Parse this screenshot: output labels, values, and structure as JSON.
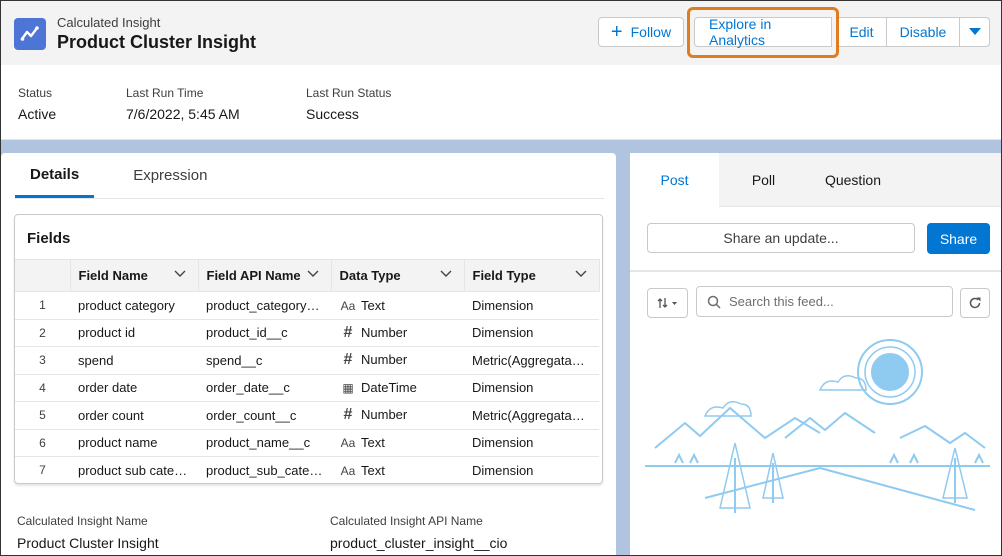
{
  "header": {
    "object_type": "Calculated Insight",
    "title": "Product Cluster Insight",
    "buttons": {
      "follow": "Follow",
      "explore": "Explore in Analytics",
      "edit": "Edit",
      "disable": "Disable"
    }
  },
  "highlights": [
    {
      "label": "Status",
      "value": "Active"
    },
    {
      "label": "Last Run Time",
      "value": "7/6/2022, 5:45 AM"
    },
    {
      "label": "Last Run Status",
      "value": "Success"
    }
  ],
  "tabs": {
    "details": "Details",
    "expression": "Expression"
  },
  "fields": {
    "title": "Fields",
    "columns": [
      "Field Name",
      "Field API Name",
      "Data Type",
      "Field Type"
    ],
    "rows": [
      {
        "n": "1",
        "name": "product category",
        "api": "product_category__c",
        "dtype": "Text",
        "dicon": "text-type-icon",
        "ftype": "Dimension"
      },
      {
        "n": "2",
        "name": "product id",
        "api": "product_id__c",
        "dtype": "Number",
        "dicon": "number-type-icon",
        "ftype": "Dimension"
      },
      {
        "n": "3",
        "name": "spend",
        "api": "spend__c",
        "dtype": "Number",
        "dicon": "number-type-icon",
        "ftype": "Metric(Aggregatabl..."
      },
      {
        "n": "4",
        "name": "order date",
        "api": "order_date__c",
        "dtype": "DateTime",
        "dicon": "calendar-type-icon",
        "ftype": "Dimension"
      },
      {
        "n": "5",
        "name": "order count",
        "api": "order_count__c",
        "dtype": "Number",
        "dicon": "number-type-icon",
        "ftype": "Metric(Aggregatabl..."
      },
      {
        "n": "6",
        "name": "product name",
        "api": "product_name__c",
        "dtype": "Text",
        "dicon": "text-type-icon",
        "ftype": "Dimension"
      },
      {
        "n": "7",
        "name": "product sub catego...",
        "api": "product_sub_categ...",
        "dtype": "Text",
        "dicon": "text-type-icon",
        "ftype": "Dimension"
      }
    ]
  },
  "bottom_fields": [
    {
      "label": "Calculated Insight Name",
      "value": "Product Cluster Insight"
    },
    {
      "label": "Calculated Insight API Name",
      "value": "product_cluster_insight__cio"
    }
  ],
  "feed": {
    "tabs": [
      "Post",
      "Poll",
      "Question"
    ],
    "share_placeholder": "Share an update...",
    "share_button": "Share",
    "search_placeholder": "Search this feed..."
  },
  "colors": {
    "brand": "#0176d3",
    "highlight_outline": "#e07b1f",
    "app_icon": "#4d75d5",
    "illustration": "#8fcaf0"
  }
}
